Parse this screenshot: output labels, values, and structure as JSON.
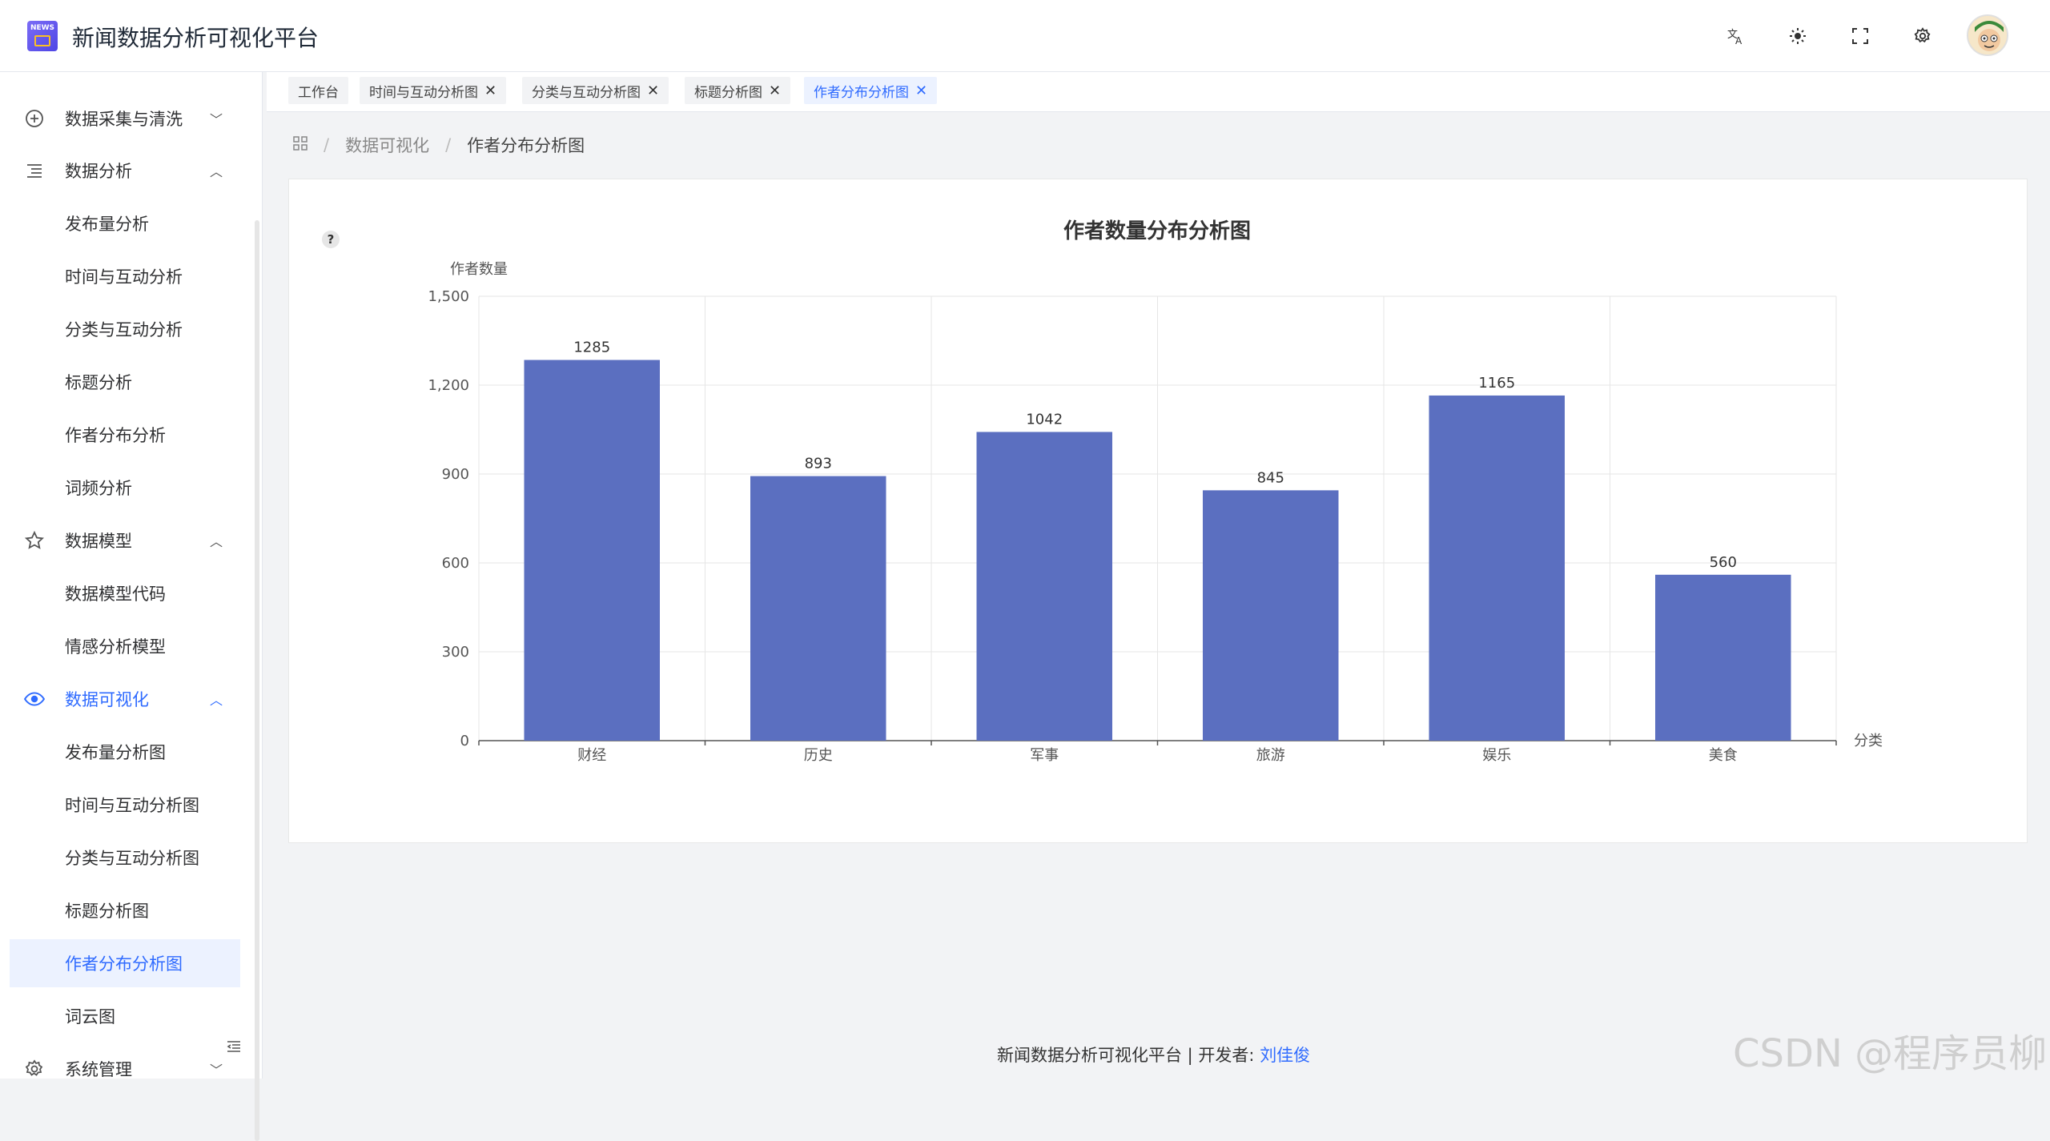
{
  "app": {
    "title": "新闻数据分析可视化平台",
    "logo_text": "NEWS"
  },
  "header_icons": [
    "translate-icon",
    "theme-icon",
    "fullscreen-icon",
    "settings-icon"
  ],
  "sidebar": {
    "groups": [
      {
        "label": "数据采集与清洗",
        "icon": "plus-circle-icon",
        "expanded": false
      },
      {
        "label": "数据分析",
        "icon": "list-icon",
        "expanded": true,
        "items": [
          "发布量分析",
          "时间与互动分析",
          "分类与互动分析",
          "标题分析",
          "作者分布分析",
          "词频分析"
        ]
      },
      {
        "label": "数据模型",
        "icon": "star-icon",
        "expanded": true,
        "items": [
          "数据模型代码",
          "情感分析模型"
        ]
      },
      {
        "label": "数据可视化",
        "icon": "eye-icon",
        "expanded": true,
        "active": true,
        "items": [
          "发布量分析图",
          "时间与互动分析图",
          "分类与互动分析图",
          "标题分析图",
          "作者分布分析图",
          "词云图"
        ]
      },
      {
        "label": "系统管理",
        "icon": "gear-icon",
        "expanded": false
      }
    ],
    "selected": "作者分布分析图"
  },
  "tabs": [
    {
      "label": "工作台",
      "closable": false
    },
    {
      "label": "时间与互动分析图",
      "closable": true
    },
    {
      "label": "分类与互动分析图",
      "closable": true
    },
    {
      "label": "标题分析图",
      "closable": true
    },
    {
      "label": "作者分布分析图",
      "closable": true,
      "active": true
    }
  ],
  "breadcrumb": [
    "数据可视化",
    "作者分布分析图"
  ],
  "chart_data": {
    "type": "bar",
    "title": "作者数量分布分析图",
    "xlabel": "分类",
    "ylabel": "作者数量",
    "categories": [
      "财经",
      "历史",
      "军事",
      "旅游",
      "娱乐",
      "美食"
    ],
    "values": [
      1285,
      893,
      1042,
      845,
      1165,
      560
    ],
    "ylim": [
      0,
      1500
    ],
    "yticks": [
      "0",
      "300",
      "600",
      "900",
      "1,200",
      "1,500"
    ],
    "grid": true,
    "bar_color": "#5b6fc0"
  },
  "footer": {
    "text": "新闻数据分析可视化平台 | 开发者:",
    "developer": "刘佳俊"
  },
  "watermark": "CSDN @程序员柳"
}
